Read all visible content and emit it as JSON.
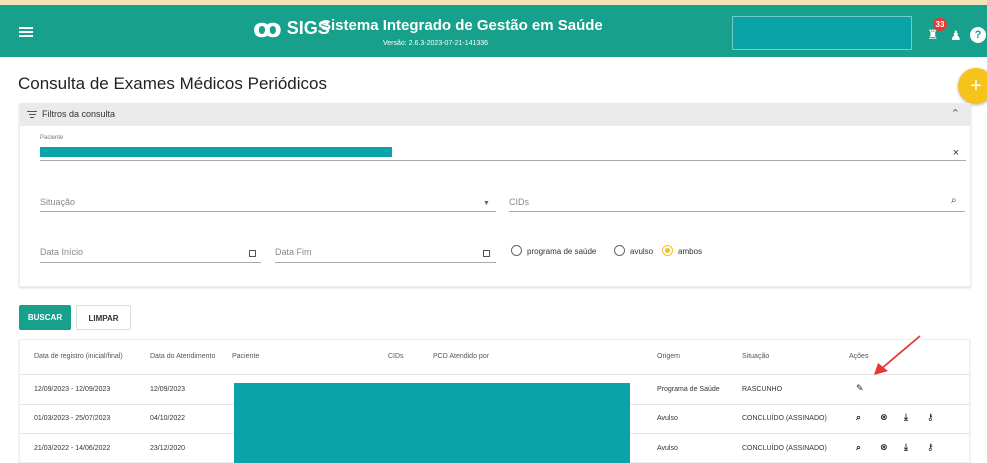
{
  "header": {
    "logo_mark": "ꝏ",
    "logo_text": "SIGS",
    "title": "Sistema Integrado de Gestão em Saúde",
    "version": "Versão: 2.6.3-2023-07-21-141336",
    "notification_count": "33",
    "notification_icon": "bell-icon",
    "user_icon": "user-icon",
    "help_icon": "help-icon",
    "help_label": "?"
  },
  "page": {
    "title": "Consulta de Exames Médicos Periódicos",
    "fab_label": "+"
  },
  "filters": {
    "title": "Filtros da consulta",
    "patient_label": "Paciente",
    "situation_placeholder": "Situação",
    "cids_placeholder": "CIDs",
    "start_date_placeholder": "Data Início",
    "end_date_placeholder": "Data Fim",
    "radio_options": [
      {
        "label": "programa de saúde",
        "selected": false
      },
      {
        "label": "avulso",
        "selected": false
      },
      {
        "label": "ambos",
        "selected": true
      }
    ]
  },
  "buttons": {
    "search": "BUSCAR",
    "clear": "LIMPAR"
  },
  "table": {
    "headers": [
      "Data de registro (inicial/final)",
      "Data do Atendimento",
      "Paciente",
      "CIDs",
      "PCD Atendido por",
      "Origem",
      "Situação",
      "Ações"
    ],
    "rows": [
      {
        "registration_period": "12/09/2023 - 12/09/2023",
        "service_date": "12/09/2023",
        "origin": "Programa de Saúde",
        "status": "RASCUNHO",
        "actions": [
          "edit-icon"
        ]
      },
      {
        "registration_period": "01/03/2023 - 25/07/2023",
        "service_date": "04/10/2022",
        "origin": "Avulso",
        "status": "CONCLUÍDO (ASSINADO)",
        "actions": [
          "search-icon",
          "cancel-icon",
          "download-icon",
          "key-icon"
        ]
      },
      {
        "registration_period": "21/03/2022 - 14/06/2022",
        "service_date": "23/12/2020",
        "origin": "Avulso",
        "status": "CONCLUÍDO (ASSINADO)",
        "actions": [
          "search-icon",
          "cancel-icon",
          "download-icon",
          "key-icon"
        ]
      }
    ]
  },
  "colors": {
    "primary": "#17a08c",
    "redaction": "#0aa3a7",
    "accent": "#f6c21c",
    "annotation": "#e53935"
  }
}
